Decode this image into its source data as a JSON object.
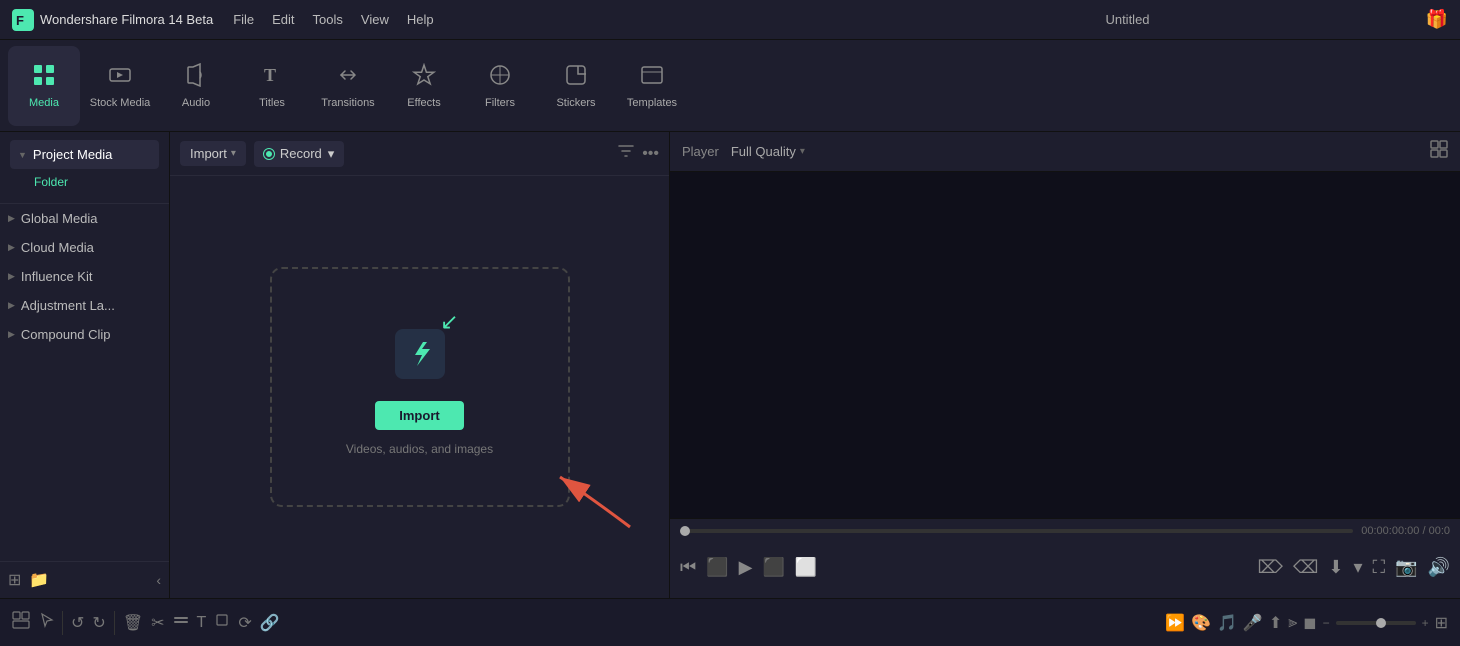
{
  "app": {
    "name": "Wondershare Filmora 14 Beta",
    "title": "Untitled"
  },
  "menu": {
    "items": [
      "File",
      "Edit",
      "Tools",
      "View",
      "Help"
    ]
  },
  "toolbar": {
    "items": [
      {
        "id": "media",
        "label": "Media",
        "icon": "▦",
        "active": true
      },
      {
        "id": "stock-media",
        "label": "Stock Media",
        "icon": "♪",
        "active": false
      },
      {
        "id": "audio",
        "label": "Audio",
        "icon": "♫",
        "active": false
      },
      {
        "id": "titles",
        "label": "Titles",
        "icon": "T",
        "active": false
      },
      {
        "id": "transitions",
        "label": "Transitions",
        "icon": "⇄",
        "active": false
      },
      {
        "id": "effects",
        "label": "Effects",
        "icon": "✦",
        "active": false
      },
      {
        "id": "filters",
        "label": "Filters",
        "icon": "⬡",
        "active": false
      },
      {
        "id": "stickers",
        "label": "Stickers",
        "icon": "◈",
        "active": false
      },
      {
        "id": "templates",
        "label": "Templates",
        "icon": "▭",
        "active": false
      }
    ]
  },
  "sidebar": {
    "sections": [
      {
        "label": "Project Media",
        "expanded": true,
        "children": [
          "Folder"
        ]
      },
      {
        "label": "Global Media",
        "expanded": false,
        "children": []
      },
      {
        "label": "Cloud Media",
        "expanded": false,
        "children": []
      },
      {
        "label": "Influence Kit",
        "expanded": false,
        "children": []
      },
      {
        "label": "Adjustment La...",
        "expanded": false,
        "children": []
      },
      {
        "label": "Compound Clip",
        "expanded": false,
        "children": []
      }
    ],
    "bottom_buttons": [
      "new-folder",
      "add-media"
    ],
    "collapse_label": "‹"
  },
  "media_toolbar": {
    "import_label": "Import",
    "record_label": "Record",
    "filter_icon": "filter",
    "more_icon": "more"
  },
  "drop_zone": {
    "import_btn_label": "Import",
    "subtitle": "Videos, audios, and images"
  },
  "player": {
    "label": "Player",
    "quality": "Full Quality",
    "time_current": "00:00:00:00",
    "time_total": "00:0",
    "controls": [
      "skip-back",
      "frame-back",
      "play",
      "frame-forward",
      "square"
    ]
  },
  "timeline": {
    "tools": [
      "layout",
      "select",
      "undo",
      "redo",
      "delete",
      "cut",
      "trim",
      "text",
      "crop",
      "rotate",
      "link"
    ],
    "zoom_minus": "−",
    "zoom_plus": "+",
    "right_tools": [
      "speed",
      "color",
      "audio",
      "mic",
      "motion",
      "split",
      "crop",
      "zoom-out",
      "zoom-slider",
      "zoom-in",
      "layout-right"
    ]
  }
}
